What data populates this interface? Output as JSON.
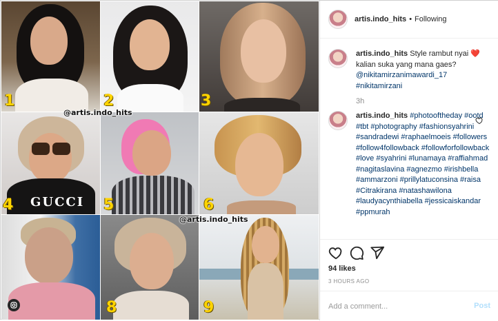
{
  "header": {
    "username": "artis.indo_hits",
    "separator": "•",
    "follow_state": "Following"
  },
  "caption": {
    "username": "artis.indo_hits",
    "text": "Style rambut nyai ❤️ kalian suka yang mana gaes?",
    "tags": [
      "@nikitamirzanimawardi_17",
      "#nikitamirzani"
    ],
    "time": "3h"
  },
  "hashtag_comment": {
    "username": "artis.indo_hits",
    "text": "#photooftheday #ootd #tbt #photography #fashionsyahrini #sandradewi #raphaelmoeis #followers #follow4followback #followforfollowback #love #syahrini #lunamaya #raffiahmad #nagitaslavina #agnezmo #irishbella #ammarzoni #prillylatuconsina #raisa #Citrakirana #natashawilona #laudyacynthiabella #jessicaiskandar #ppmurah"
  },
  "collage": {
    "numbers": [
      "1",
      "2",
      "3",
      "4",
      "5",
      "6",
      "7",
      "8",
      "9"
    ],
    "watermark": "@artis.indo_hits",
    "shirt_text": "GUCCI"
  },
  "footer": {
    "likes": "94 likes",
    "posted_ago": "3 HOURS AGO",
    "comment_placeholder": "Add a comment...",
    "post_label": "Post"
  },
  "colors": {
    "number_color": "#ffd400",
    "link_color": "#003569",
    "post_color": "#b2dffc",
    "muted": "#8e8e8e"
  },
  "icons": [
    "heart-icon",
    "comment-icon",
    "share-icon",
    "small-heart-icon",
    "instagram-icon"
  ]
}
